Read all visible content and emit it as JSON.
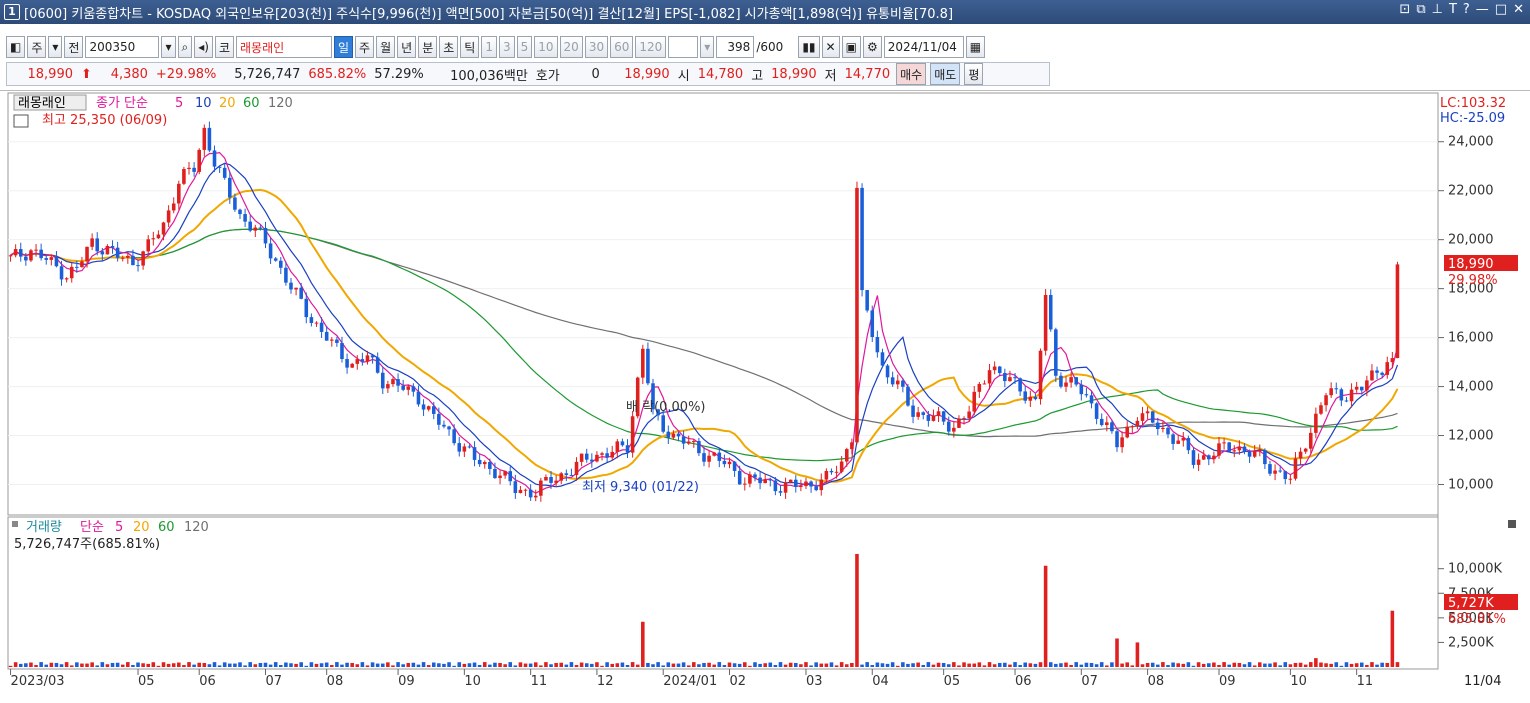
{
  "window": {
    "number": "1",
    "title": "[0600] 키움종합차트 - KOSDAQ 외국인보유[203(천)] 주식수[9,996(천)] 액면[500] 자본금[50(억)] 결산[12월] EPS[-1,082] 시가총액[1,898(억)] 유통비율[70.8]",
    "controls": [
      "⊡",
      "⧉",
      "⊥",
      "T",
      "?",
      "—",
      "□",
      "✕"
    ]
  },
  "toolbar": {
    "type_label": "주",
    "prev_label": "전",
    "code": "200350",
    "market_label": "코",
    "stock_name": "래몽래인",
    "periods": [
      "일",
      "주",
      "월",
      "년"
    ],
    "period_selected": "일",
    "intraday": [
      "분",
      "초",
      "틱"
    ],
    "intervals": [
      "1",
      "3",
      "5",
      "10",
      "20",
      "30",
      "60",
      "120"
    ],
    "count": "398",
    "count_max": "/600",
    "date": "2024/11/04"
  },
  "quote": {
    "price": "18,990",
    "change": "4,380",
    "change_pct": "+29.98%",
    "volume": "5,726,747",
    "volume_ratio": "685.82%",
    "turnover": "57.29%",
    "amount": "100,036백만",
    "hoga_label": "호가",
    "hoga": "0",
    "ask": "18,990",
    "open_label": "시",
    "open": "14,780",
    "high_label": "고",
    "high": "18,990",
    "low_label": "저",
    "low": "14,770",
    "buy_label": "매수",
    "sell_label": "매도",
    "eval_label": "평"
  },
  "chart_data": [
    {
      "type": "candlestick",
      "title": "래몽래인",
      "legend": [
        "종가 단순",
        "5",
        "10",
        "20",
        "60",
        "120"
      ],
      "ma_colors": {
        "5": "#e0189a",
        "10": "#1a3fc0",
        "20": "#f0a800",
        "60": "#1c9a30",
        "120": "#707070"
      },
      "up_color": "#e0201e",
      "down_color": "#1a5fd8",
      "ylim": [
        9000,
        25500
      ],
      "y_ticks": [
        "10,000",
        "12,000",
        "14,000",
        "16,000",
        "18,000",
        "20,000",
        "22,000",
        "24,000"
      ],
      "x_ticks": [
        "2023/03",
        "05",
        "06",
        "07",
        "08",
        "09",
        "10",
        "11",
        "12",
        "2024/01",
        "02",
        "03",
        "04",
        "05",
        "06",
        "07",
        "08",
        "09",
        "10",
        "11"
      ],
      "x_end_label": "11/04",
      "lc": "LC:103.32",
      "hc": "HC:-25.09",
      "last_price": "18,990",
      "last_pct": "29.98%",
      "high_note": "최고 25,350 (06/09)",
      "low_note": "최저 9,340 (01/22)",
      "mid_note": "배 락(0.00%)",
      "trend": [
        [
          0,
          19200
        ],
        [
          4,
          19600
        ],
        [
          8,
          19000
        ],
        [
          11,
          18600
        ],
        [
          13,
          18800
        ],
        [
          16,
          19900
        ],
        [
          19,
          19600
        ],
        [
          21,
          19300
        ],
        [
          24,
          19100
        ],
        [
          27,
          19700
        ],
        [
          30,
          20600
        ],
        [
          33,
          22400
        ],
        [
          36,
          22900
        ],
        [
          38,
          24500
        ],
        [
          40,
          23200
        ],
        [
          42,
          22200
        ],
        [
          45,
          21000
        ],
        [
          48,
          20400
        ],
        [
          52,
          19200
        ],
        [
          55,
          18000
        ],
        [
          59,
          16800
        ],
        [
          63,
          15700
        ],
        [
          67,
          14900
        ],
        [
          70,
          15200
        ],
        [
          73,
          14300
        ],
        [
          77,
          13900
        ],
        [
          80,
          13600
        ],
        [
          83,
          12700
        ],
        [
          87,
          11900
        ],
        [
          91,
          11000
        ],
        [
          95,
          10600
        ],
        [
          99,
          9800
        ],
        [
          103,
          9700
        ],
        [
          106,
          10200
        ],
        [
          110,
          10600
        ],
        [
          114,
          11200
        ],
        [
          118,
          11300
        ],
        [
          121,
          11600
        ],
        [
          124,
          15600
        ],
        [
          126,
          12800
        ],
        [
          130,
          12000
        ],
        [
          134,
          11500
        ],
        [
          138,
          11100
        ],
        [
          141,
          10700
        ],
        [
          144,
          10200
        ],
        [
          148,
          10100
        ],
        [
          152,
          9900
        ],
        [
          156,
          10000
        ],
        [
          160,
          10200
        ],
        [
          163,
          10900
        ],
        [
          165,
          12000
        ],
        [
          166,
          22200
        ],
        [
          167,
          17600
        ],
        [
          169,
          16200
        ],
        [
          171,
          14800
        ],
        [
          174,
          14000
        ],
        [
          177,
          13000
        ],
        [
          181,
          12700
        ],
        [
          185,
          12400
        ],
        [
          188,
          13000
        ],
        [
          192,
          14900
        ],
        [
          195,
          14300
        ],
        [
          198,
          14000
        ],
        [
          201,
          13300
        ],
        [
          203,
          17700
        ],
        [
          205,
          14500
        ],
        [
          209,
          14000
        ],
        [
          213,
          13000
        ],
        [
          217,
          11600
        ],
        [
          221,
          12900
        ],
        [
          225,
          12400
        ],
        [
          229,
          11800
        ],
        [
          232,
          11000
        ],
        [
          236,
          11300
        ],
        [
          240,
          11600
        ],
        [
          244,
          11200
        ],
        [
          248,
          10600
        ],
        [
          251,
          10200
        ],
        [
          254,
          11800
        ],
        [
          258,
          13700
        ],
        [
          262,
          13700
        ],
        [
          265,
          13900
        ],
        [
          268,
          14700
        ],
        [
          270,
          15000
        ],
        [
          271,
          14900
        ],
        [
          272,
          18990
        ]
      ],
      "volume": {
        "legend": [
          "거래량",
          "단순",
          "5",
          "20",
          "60",
          "120"
        ],
        "current": "5,726,747주(685.81%)",
        "y_ticks": [
          "2,500K",
          "5,000K",
          "7,500K",
          "10,000K"
        ],
        "last": "5,727K",
        "last_pct": "685.81%",
        "spikes": [
          [
            124,
            4600
          ],
          [
            166,
            11500
          ],
          [
            203,
            10300
          ],
          [
            217,
            2900
          ],
          [
            221,
            2500
          ],
          [
            256,
            900
          ],
          [
            271,
            5727
          ]
        ]
      }
    }
  ]
}
